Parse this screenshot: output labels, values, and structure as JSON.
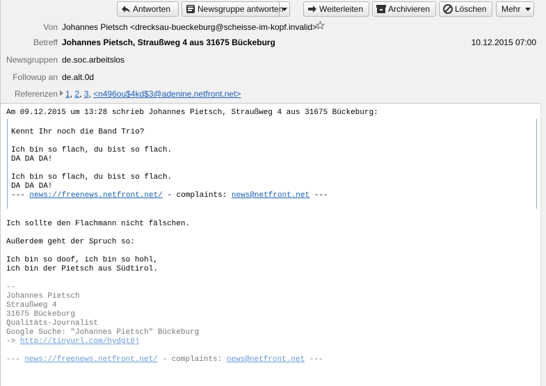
{
  "toolbar": {
    "reply": "Antworten",
    "reply_newsgroup": "Newsgruppe antworten",
    "forward": "Weiterleiten",
    "archive": "Archivieren",
    "delete": "Löschen",
    "more": "Mehr"
  },
  "headers": {
    "from_label": "Von",
    "from_value": "Johannes Pietsch <drecksau-bueckeburg@scheisse-im-kopf.invalid>",
    "subject_label": "Betreff",
    "subject_value": "Johannes Pietsch, Straußweg 4 aus 31675 Bückeburg",
    "date": "10.12.2015 07:00",
    "newsgroups_label": "Newsgruppen",
    "newsgroups_value": "de.soc.arbeitslos",
    "followup_label": "Followup an",
    "followup_value": "de.alt.0d",
    "references_label": "Referenzen",
    "ref1": "1",
    "ref2": "2",
    "ref3": "3",
    "ref_msgid": "<n496ou$4kd$3@adenine.netfront.net>"
  },
  "body": {
    "intro": "Am 09.12.2015 um 13:28 schrieb Johannes Pietsch, Straußweg 4 aus 31675 Bückeburg:",
    "quote": [
      "Kennt Ihr noch die Band Trio?",
      "Ich bin so flach, du bist so flach.",
      "DA DA DA!",
      "Ich bin so flach, du bist so flach.",
      "DA DA DA!"
    ],
    "quote_footer_prefix": "--- ",
    "quote_footer_link1": "news://freenews.netfront.net/",
    "quote_footer_mid": " - complaints: ",
    "quote_footer_link2": "news@netfront.net",
    "quote_footer_suffix": " ---",
    "paragraphs": [
      "Ich sollte den Flachmann nicht fälschen.",
      "Außerdem geht der Spruch so:",
      "Ich bin so doof, ich bin so hohl,",
      "ich bin der Pietsch aus Südtirol."
    ],
    "signature": [
      "--",
      "Johannes Pietsch",
      "Straußweg 4",
      "31675 Bückeburg",
      "Qualitäts-Journalist",
      "Google Suche: \"Johannes Pietsch\" Bückeburg"
    ],
    "sig_arrow": "-> ",
    "sig_link": "http://tinyurl.com/hydgt6j",
    "footer_prefix": "--- ",
    "footer_link1": "news://freenews.netfront.net/",
    "footer_mid": " - complaints: ",
    "footer_link2": "news@netfront.net",
    "footer_suffix": " ---"
  }
}
